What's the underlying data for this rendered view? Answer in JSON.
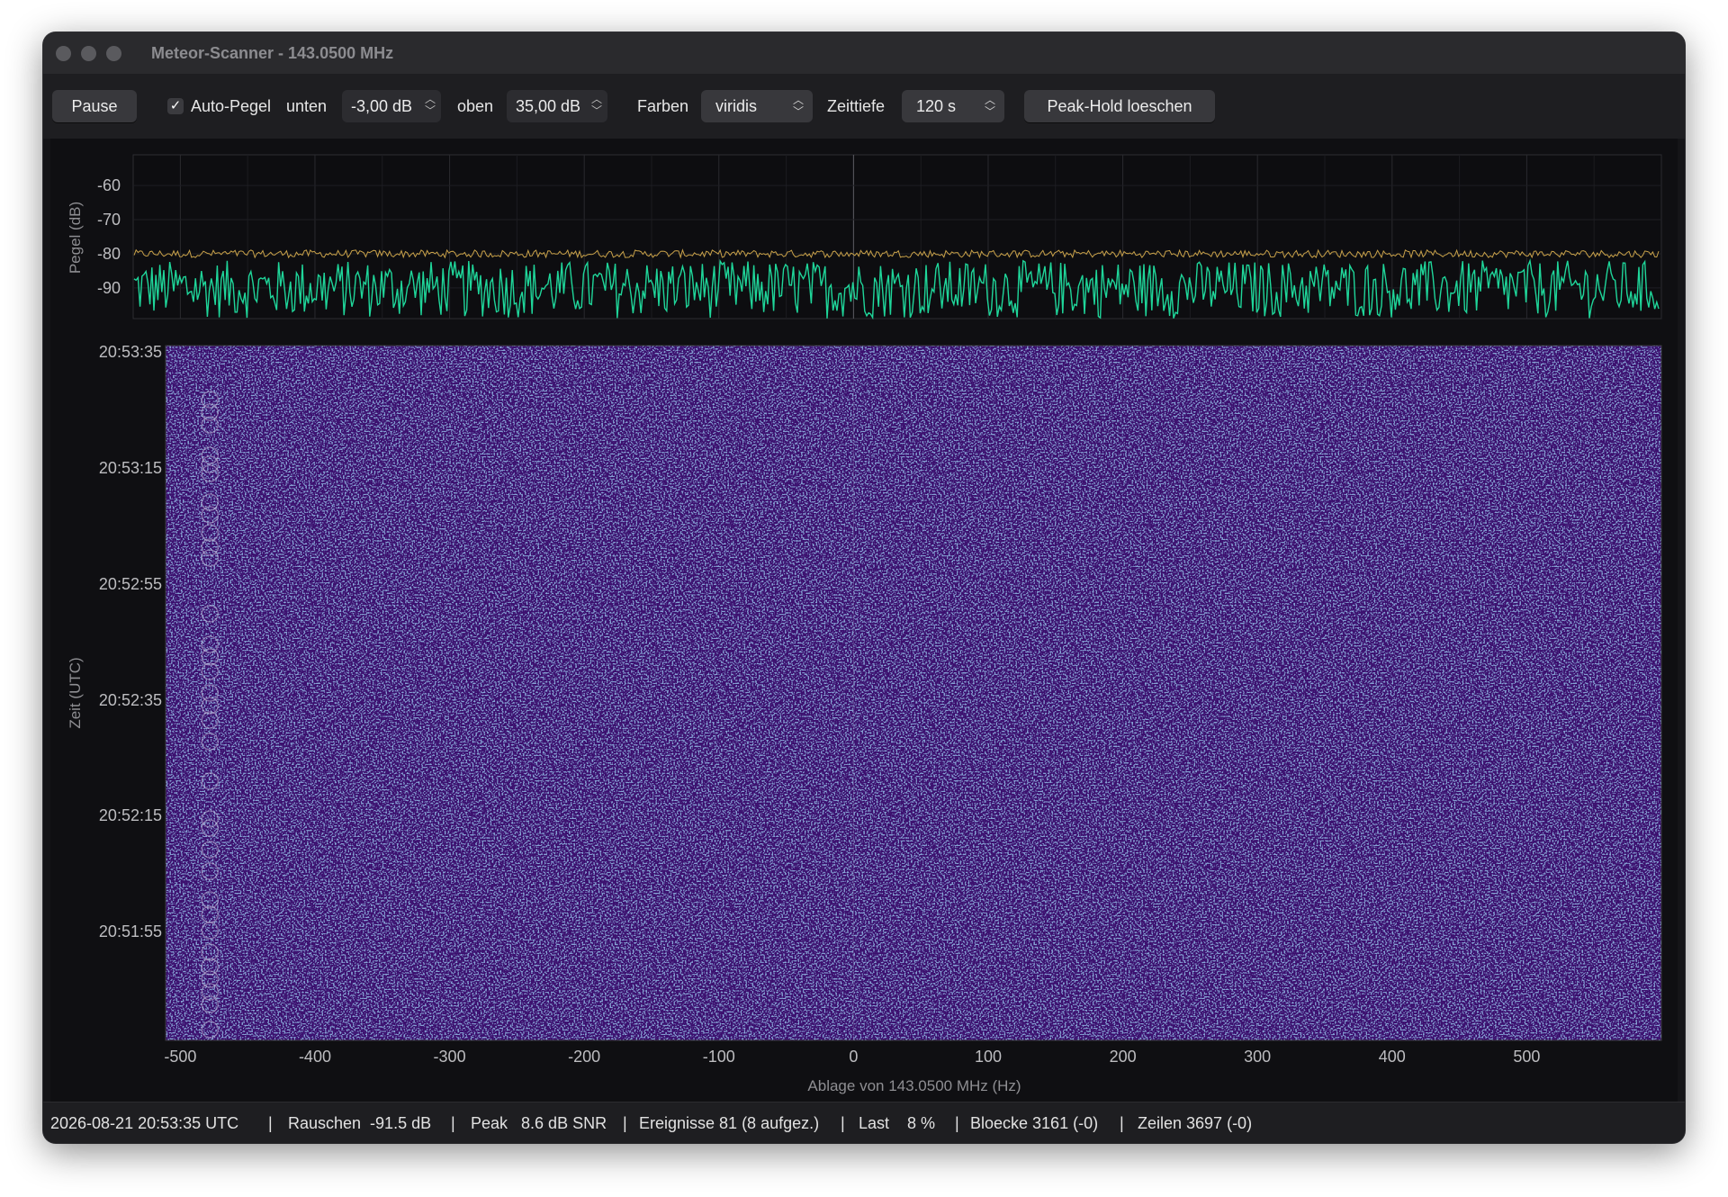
{
  "window": {
    "title": "Meteor-Scanner - 143.0500 MHz"
  },
  "toolbar": {
    "pause_label": "Pause",
    "auto_level_checked": true,
    "auto_level_label": "Auto-Pegel",
    "lower_label": "unten",
    "lower_value": "-3,00 dB",
    "upper_label": "oben",
    "upper_value": "35,00 dB",
    "colors_label": "Farben",
    "colors_value": "viridis",
    "depth_label": "Zeittiefe",
    "depth_value": "120 s",
    "peak_hold_label": "Peak-Hold loeschen"
  },
  "spectrum": {
    "ylabel": "Pegel (dB)",
    "yticks": [
      "-60",
      "-70",
      "-80",
      "-90"
    ],
    "ytick_values": [
      -60,
      -70,
      -80,
      -90
    ],
    "ylim": [
      -99,
      -51
    ],
    "xlim": [
      -535,
      600
    ],
    "live_color": "#1fd69a",
    "peak_color": "#c9a24a"
  },
  "waterfall": {
    "ylabel": "Zeit (UTC)",
    "yticks": [
      "20:53:35",
      "20:53:15",
      "20:52:55",
      "20:52:35",
      "20:52:15",
      "20:51:55"
    ],
    "xticks": [
      "-500",
      "-400",
      "-300",
      "-200",
      "-100",
      "0",
      "100",
      "200",
      "300",
      "400",
      "500"
    ],
    "xtick_values": [
      -500,
      -400,
      -300,
      -200,
      -100,
      0,
      100,
      200,
      300,
      400,
      500
    ],
    "xlabel": "Ablage von 143.0500 MHz (Hz)",
    "xlim": [
      -535,
      600
    ],
    "base_color": "#3b0f6e",
    "speckle_color": "#3d5aa8",
    "event_offset_hz": -478
  },
  "status": {
    "timestamp": "2026-08-21 20:53:35 UTC",
    "noise": "Rauschen  -91.5 dB",
    "peak": "Peak   8.6 dB SNR",
    "events": "Ereignisse 81 (8 aufgez.)",
    "load": "Last    8 %",
    "blocks": "Bloecke 3161 (-0)",
    "rows": "Zeilen 3697 (-0)",
    "sep": "|"
  }
}
